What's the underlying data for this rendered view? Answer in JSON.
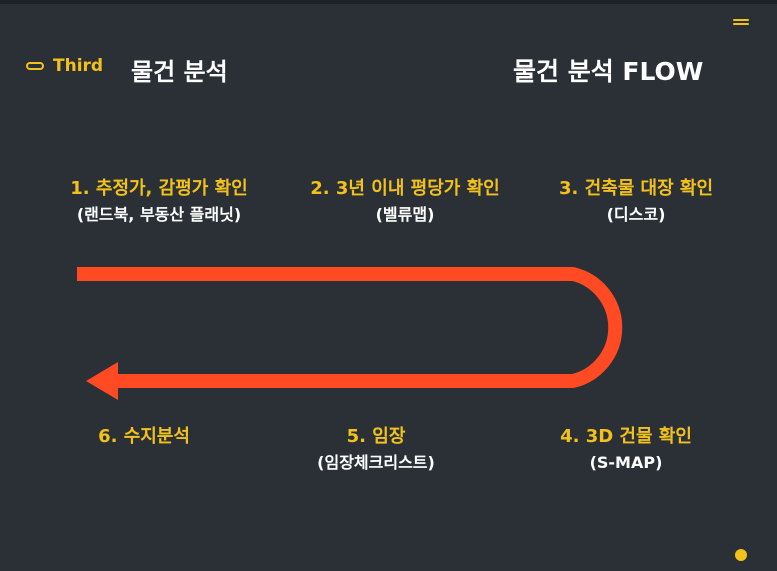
{
  "header": {
    "section_label": "Third",
    "title_left": "물건 분석",
    "title_right": "물건 분석 FLOW"
  },
  "steps": [
    {
      "title": "1. 추정가, 감평가 확인",
      "sub": "(랜드북, 부동산 플래닛)"
    },
    {
      "title": "2. 3년 이내 평당가 확인",
      "sub": "(벨류맵)"
    },
    {
      "title": "3. 건축물 대장 확인",
      "sub": "(디스코)"
    },
    {
      "title": "4. 3D 건물 확인",
      "sub": "(S-MAP)"
    },
    {
      "title": "5. 임장",
      "sub": "(임장체크리스트)"
    },
    {
      "title": "6. 수지분석",
      "sub": ""
    }
  ],
  "colors": {
    "background": "#2b3037",
    "accent": "#f2c21b",
    "arrow": "#ff4a23",
    "text": "#ffffff"
  },
  "icons": {
    "menu": "menu-icon",
    "section": "pill-icon",
    "arrow": "u-turn-arrow",
    "corner": "dot-icon"
  }
}
